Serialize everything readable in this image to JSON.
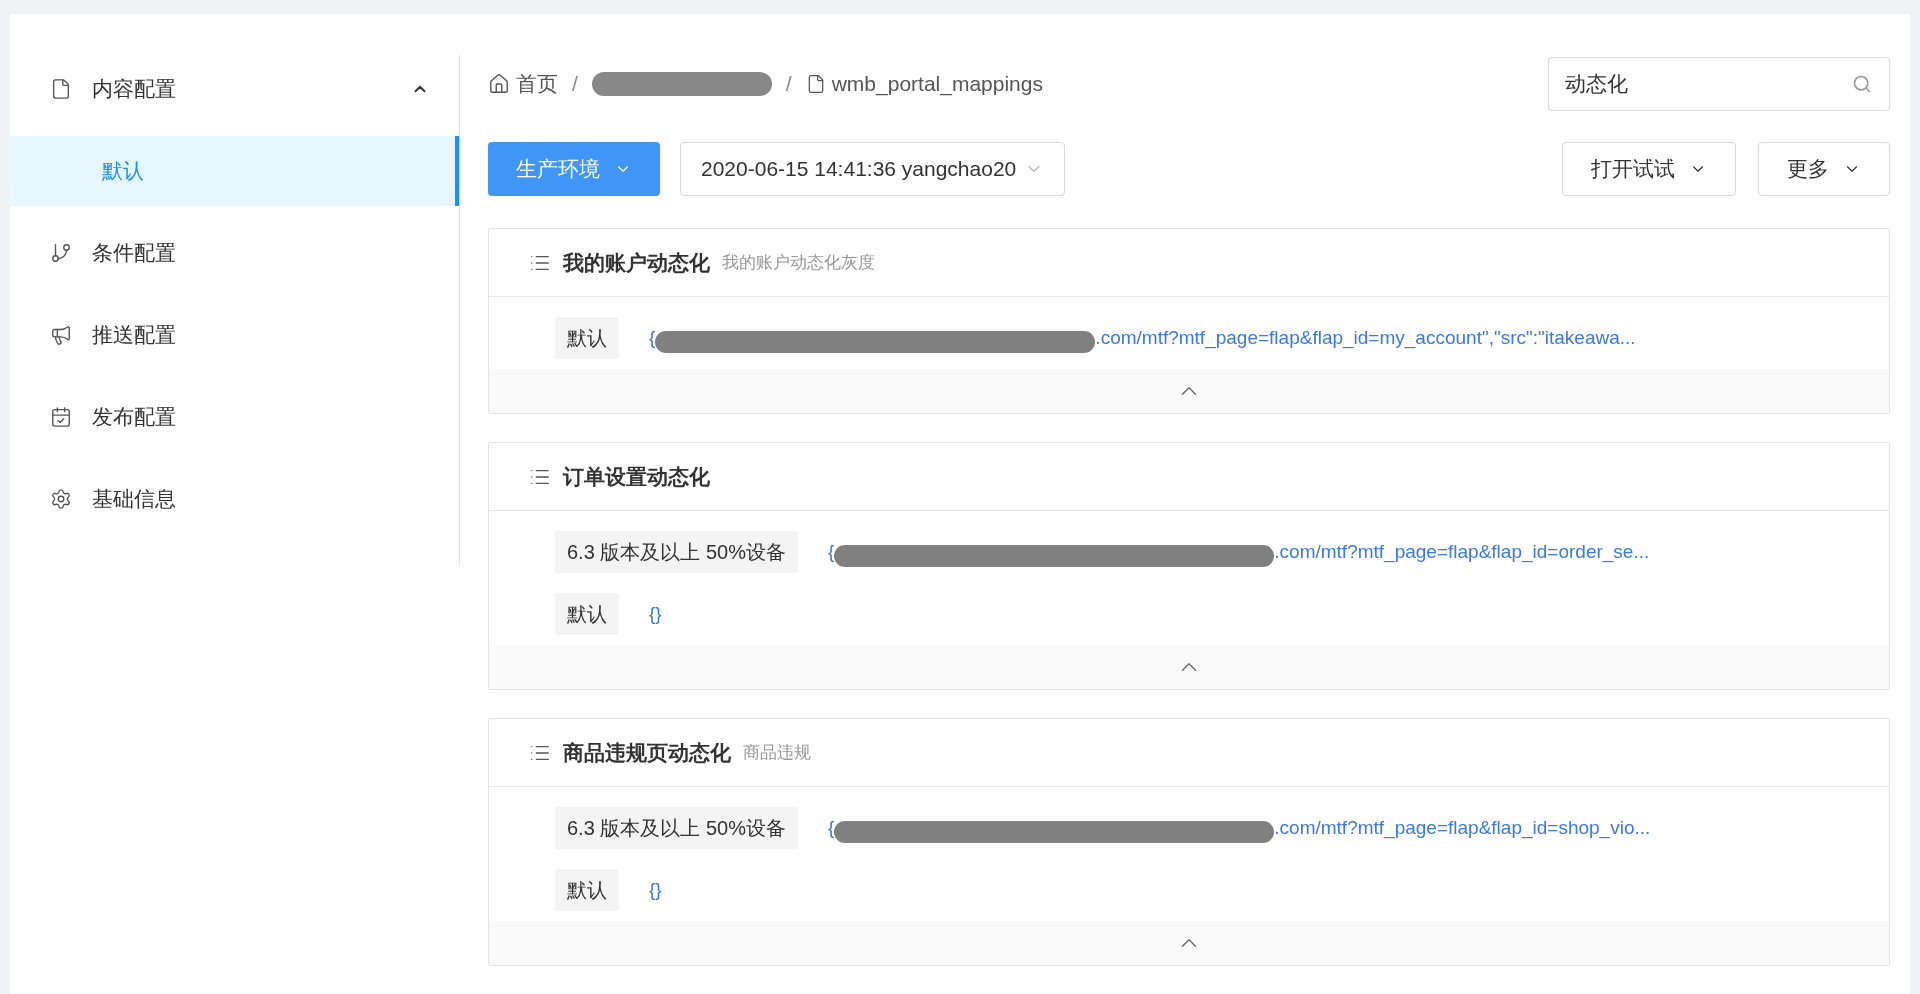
{
  "sidebar": {
    "items": [
      {
        "kind": "group",
        "label": "内容配置",
        "expanded": true,
        "children": [
          {
            "label": "默认",
            "selected": true
          }
        ]
      },
      {
        "kind": "item",
        "label": "条件配置",
        "selected": false
      },
      {
        "kind": "item",
        "label": "推送配置",
        "selected": false
      },
      {
        "kind": "item",
        "label": "发布配置",
        "selected": false
      },
      {
        "kind": "item",
        "label": "基础信息",
        "selected": false
      }
    ]
  },
  "breadcrumb": [
    {
      "kind": "home",
      "label": "首页"
    },
    {
      "kind": "separator",
      "label": "/"
    },
    {
      "kind": "redacted"
    },
    {
      "kind": "separator",
      "label": "/"
    },
    {
      "kind": "file",
      "label": "wmb_portal_mappings"
    }
  ],
  "search": {
    "value": "动态化"
  },
  "toolbar": {
    "environment": "生产环境",
    "version": "2020-06-15 14:41:36 yangchao20",
    "actions": [
      "打开试试",
      "更多"
    ]
  },
  "cards": [
    {
      "title": "我的账户动态化",
      "subtitle": "我的账户动态化灰度",
      "expanded": true,
      "rows": [
        {
          "tag": "默认",
          "prefix": "{",
          "redacted": true,
          "suffix": ".com/mtf?mtf_page=flap&flap_id=my_account\",\"src\":\"itakeawa..."
        }
      ]
    },
    {
      "title": "订单设置动态化",
      "expanded": true,
      "rows": [
        {
          "tag": "6.3 版本及以上 50%设备",
          "prefix": "{",
          "redacted": true,
          "suffix": ".com/mtf?mtf_page=flap&flap_id=order_se..."
        },
        {
          "tag": "默认",
          "prefix": "{}",
          "redacted": false
        }
      ]
    },
    {
      "title": "商品违规页动态化",
      "subtitle": "商品违规",
      "expanded": true,
      "rows": [
        {
          "tag": "6.3 版本及以上 50%设备",
          "prefix": "{",
          "redacted": true,
          "suffix": ".com/mtf?mtf_page=flap&flap_id=shop_vio..."
        },
        {
          "tag": "默认",
          "prefix": "{}",
          "redacted": false
        }
      ]
    }
  ]
}
